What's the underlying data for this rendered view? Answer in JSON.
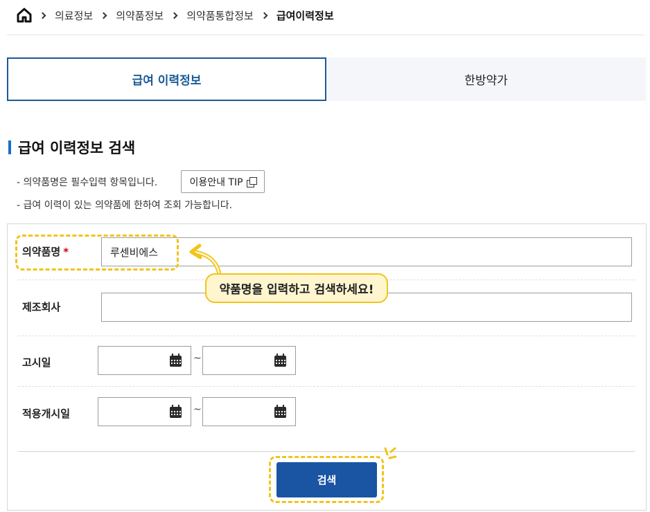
{
  "breadcrumb": {
    "items": [
      "의료정보",
      "의약품정보",
      "의약품통합정보",
      "급여이력정보"
    ]
  },
  "tabs": [
    {
      "label": "급여 이력정보",
      "active": true
    },
    {
      "label": "한방약가",
      "active": false
    }
  ],
  "section": {
    "title": "급여 이력정보 검색",
    "notes": [
      "- 의약품명은 필수입력 항목입니다.",
      "- 급여 이력이 있는 의약품에 한하여 조회 가능합니다."
    ],
    "tip_button": "이용안내 TIP"
  },
  "form": {
    "drug_name": {
      "label": "의약품명",
      "required_mark": "*",
      "value": "루센비에스"
    },
    "manufacturer": {
      "label": "제조회사",
      "value": ""
    },
    "notice_date": {
      "label": "고시일",
      "separator": "~"
    },
    "apply_date": {
      "label": "적용개시일",
      "separator": "~"
    },
    "search_button": "검색"
  },
  "annotation": {
    "callout": "약품명을 입력하고 검색하세요!"
  },
  "colors": {
    "accent": "#1a5a96",
    "button": "#1a55a3",
    "highlight": "#f0c419",
    "required": "#d0021b"
  }
}
